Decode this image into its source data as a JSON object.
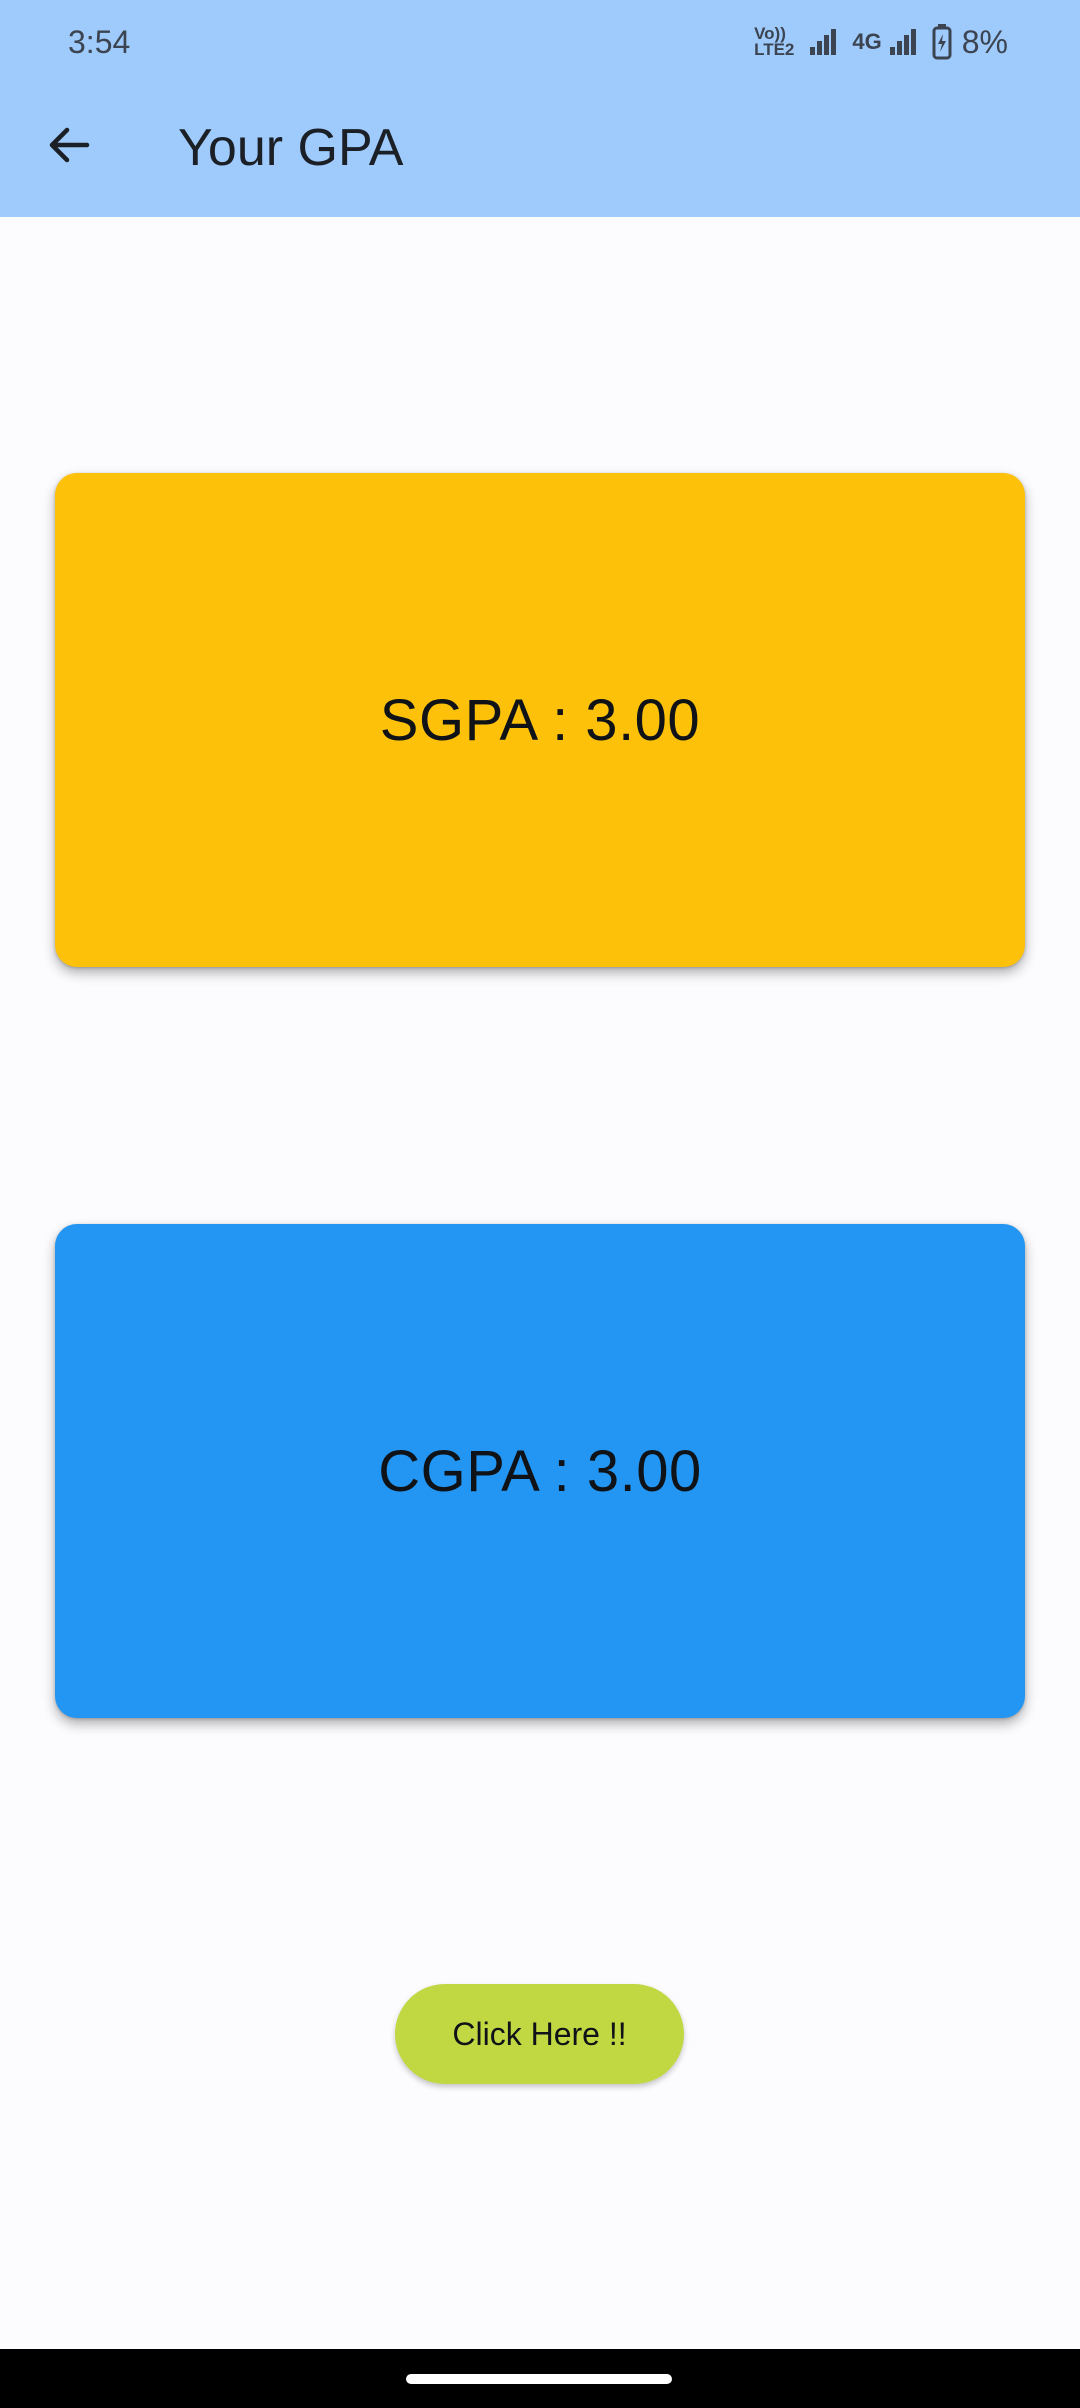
{
  "status_bar": {
    "time": "3:54",
    "volte_label_top": "Vo))",
    "volte_label_bottom": "LTE2",
    "network_label": "4G",
    "battery_percent": "8%"
  },
  "app_bar": {
    "title": "Your GPA",
    "background_color": "#9fcafc"
  },
  "cards": {
    "sgpa": {
      "text": "SGPA : 3.00",
      "color": "#fdc10a"
    },
    "cgpa": {
      "text": "CGPA : 3.00",
      "color": "#2396f3"
    }
  },
  "action_button": {
    "label": "Click Here !!",
    "color": "#c1d843"
  },
  "icons": {
    "back": "arrow-left",
    "signal": "signal-bars",
    "battery": "battery-charging"
  }
}
